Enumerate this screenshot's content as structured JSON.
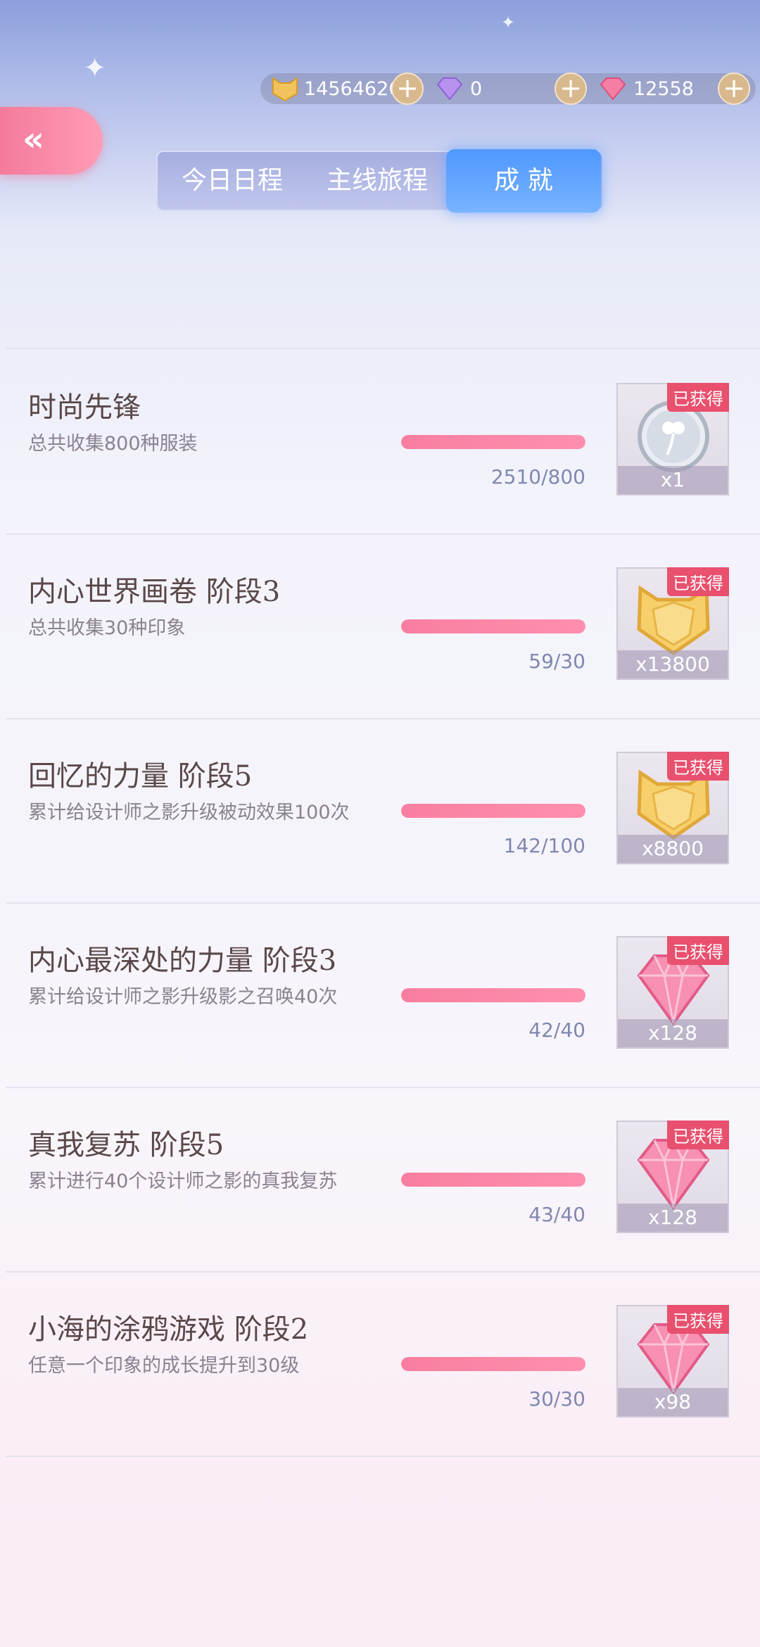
{
  "currency": {
    "coins": "14564626",
    "purple_diamonds": "0",
    "pink_diamonds": "12558"
  },
  "back_label": "«",
  "tabs": [
    {
      "label": "今日日程",
      "active": false
    },
    {
      "label": "主线旅程",
      "active": false
    },
    {
      "label": "成 就",
      "active": true
    }
  ],
  "achievements": [
    {
      "title": "时尚先锋",
      "desc": "总共收集800种服装",
      "progress_text": "2510/800",
      "progress": 1.0,
      "badge": "已获得",
      "reward_qty": "x1",
      "reward_icon": "silver-coin-icon"
    },
    {
      "title": "内心世界画卷 阶段3",
      "desc": "总共收集30种印象",
      "progress_text": "59/30",
      "progress": 1.0,
      "badge": "已获得",
      "reward_qty": "x13800",
      "reward_icon": "gold-cat-coin-icon"
    },
    {
      "title": "回忆的力量 阶段5",
      "desc": "累计给设计师之影升级被动效果100次",
      "progress_text": "142/100",
      "progress": 1.0,
      "badge": "已获得",
      "reward_qty": "x8800",
      "reward_icon": "gold-cat-coin-icon"
    },
    {
      "title": "内心最深处的力量 阶段3",
      "desc": "累计给设计师之影升级影之召唤40次",
      "progress_text": "42/40",
      "progress": 1.0,
      "badge": "已获得",
      "reward_qty": "x128",
      "reward_icon": "pink-diamond-icon"
    },
    {
      "title": "真我复苏 阶段5",
      "desc": "累计进行40个设计师之影的真我复苏",
      "progress_text": "43/40",
      "progress": 1.0,
      "badge": "已获得",
      "reward_qty": "x128",
      "reward_icon": "pink-diamond-icon"
    },
    {
      "title": "小海的涂鸦游戏 阶段2",
      "desc": "任意一个印象的成长提升到30级",
      "progress_text": "30/30",
      "progress": 1.0,
      "badge": "已获得",
      "reward_qty": "x98",
      "reward_icon": "pink-diamond-icon"
    }
  ],
  "colors": {
    "accent_pink": "#f87ea0",
    "badge_red": "#e8506e",
    "tab_active_blue": "#5fa3ff"
  }
}
